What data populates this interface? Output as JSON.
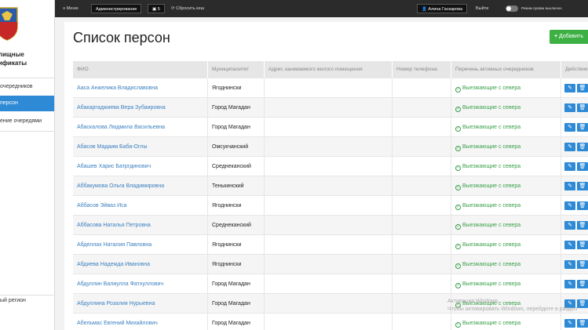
{
  "sidebar": {
    "brand_line1": "лищные",
    "brand_line2": "ификаты",
    "items": [
      {
        "label": "очередников"
      },
      {
        "label": "персон"
      },
      {
        "label": "ение очередями"
      }
    ],
    "region": "ый регион"
  },
  "topbar": {
    "menu_label": "Меню",
    "admin_label": "Администрирование",
    "count": "5",
    "reset_label": "Сбросить кеш",
    "user_name": "Алина Гаскарова",
    "logout_label": "Выйти",
    "mode_label": "Режим правки",
    "mode_state": "выключен"
  },
  "page": {
    "title": "Список персон",
    "add_label": "Добавить"
  },
  "table": {
    "columns": [
      "ФИО",
      "Муниципалитет",
      "Адрес занимаемого жилого помещения",
      "Номер телефона",
      "Перечень активных очередников",
      "Действия"
    ],
    "rows": [
      {
        "name": "Ааса Анжелика Владиславовна",
        "muni": "Ягоднински",
        "queue": "Выезжающие с севера"
      },
      {
        "name": "Абакаргаджиева Вера Зубаировна",
        "muni": "Город Магадан",
        "queue": "Выезжающие с севера"
      },
      {
        "name": "Абаскалова Людмила Васильевна",
        "muni": "Город Магадан",
        "queue": "Выезжающие с севера"
      },
      {
        "name": "Абасов Мадаим Баба-Оглы",
        "muni": "Омсукчанский",
        "queue": "Выезжающие с севера"
      },
      {
        "name": "Абашев Харис Батргдинович",
        "muni": "Среднеканский",
        "queue": "Выезжающие с севера"
      },
      {
        "name": "Аббакумова Ольга Владимировна",
        "muni": "Тенькинский",
        "queue": "Выезжающие с севера"
      },
      {
        "name": "Аббасов Эйваз Иса",
        "muni": "Ягоднински",
        "queue": "Выезжающие с севера"
      },
      {
        "name": "Аббасова Наталья Петровна",
        "muni": "Среднеканский",
        "queue": "Выезжающие с севера"
      },
      {
        "name": "Абделлах Наталия Павловна",
        "muni": "Ягоднински",
        "queue": "Выезжающие с севера"
      },
      {
        "name": "Абдиева Надежда Ивановна",
        "muni": "Ягоднински",
        "queue": "Выезжающие с севера"
      },
      {
        "name": "Абдуллин Валиулла Фатхуллович",
        "muni": "Город Магадан",
        "queue": "Выезжающие с севера"
      },
      {
        "name": "Абдуллина Розалия Нурыевна",
        "muni": "Город Магадан",
        "queue": "Выезжающие с севера"
      },
      {
        "name": "Абельмас Евгений Михайлович",
        "muni": "Город Магадан",
        "queue": "Выезжающие с севера"
      }
    ]
  },
  "watermark": {
    "line1": "Активация Windows",
    "line2": "Чтобы активировать Windows, перейдите в раздел"
  }
}
